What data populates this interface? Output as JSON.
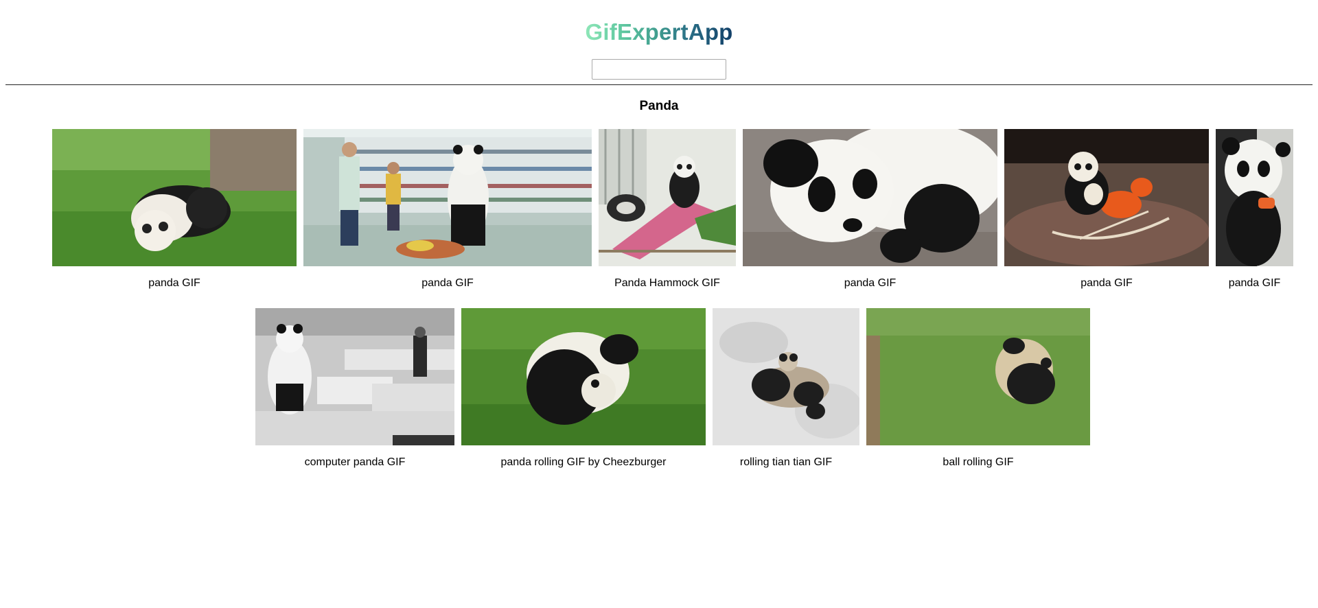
{
  "app": {
    "title": "GifExpertApp"
  },
  "search": {
    "value": "",
    "placeholder": ""
  },
  "category": {
    "title": "Panda"
  },
  "gifs": [
    {
      "title": "panda GIF",
      "icon": "panda-grass-image"
    },
    {
      "title": "panda GIF",
      "icon": "panda-supermarket-image"
    },
    {
      "title": "Panda Hammock GIF",
      "icon": "panda-hammock-image"
    },
    {
      "title": "panda GIF",
      "icon": "panda-lying-image"
    },
    {
      "title": "panda GIF",
      "icon": "panda-rocking-horse-image"
    },
    {
      "title": "panda GIF",
      "icon": "panda-eating-image"
    },
    {
      "title": "computer panda GIF",
      "icon": "panda-office-image"
    },
    {
      "title": "panda rolling GIF by Cheezburger",
      "icon": "panda-rolling-grass-image"
    },
    {
      "title": "rolling tian tian GIF",
      "icon": "panda-snow-image"
    },
    {
      "title": "ball rolling GIF",
      "icon": "panda-ball-rolling-image"
    }
  ],
  "colors": {
    "title_gradient": [
      "#8fe7b8",
      "#5fc8a0",
      "#3f9b8e",
      "#2a6f86",
      "#123f68"
    ],
    "divider": "#222222"
  }
}
